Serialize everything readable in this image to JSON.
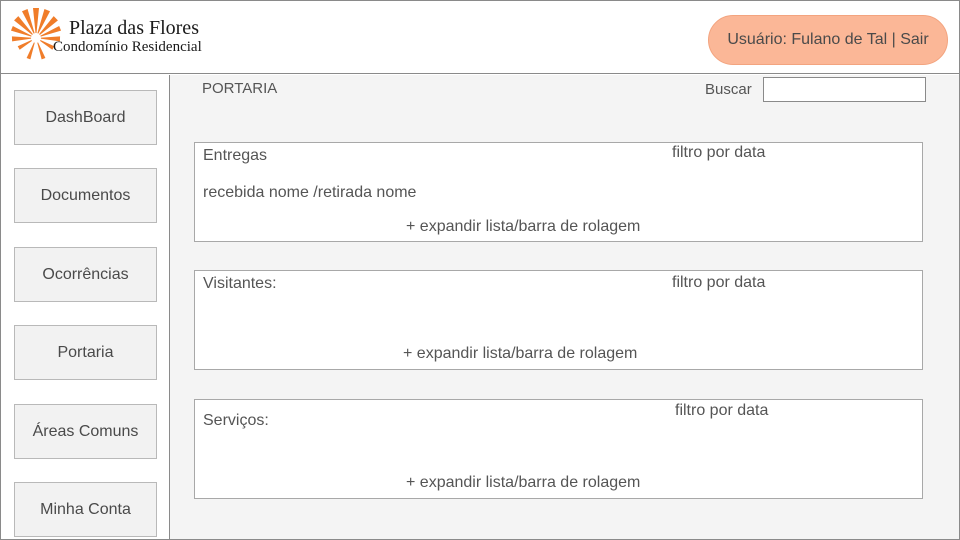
{
  "header": {
    "brand_title": "Plaza das Flores",
    "brand_subtitle": "Condomínio Residencial",
    "user_label": "Usuário: Fulano de Tal | Sair",
    "logo_icon": "flower-sun-logo-icon",
    "accent_color": "#fbb797",
    "logo_color": "#f07d2a"
  },
  "sidebar": {
    "items": [
      {
        "label": "DashBoard"
      },
      {
        "label": "Documentos"
      },
      {
        "label": "Ocorrências"
      },
      {
        "label": "Portaria"
      },
      {
        "label": "Áreas Comuns"
      },
      {
        "label": "Minha Conta"
      }
    ]
  },
  "main": {
    "page_title": "PORTARIA",
    "search_label": "Buscar",
    "search_value": "",
    "panels": [
      {
        "title": "Entregas",
        "filter": "filtro por data",
        "row": "recebida nome /retirada nome",
        "expand": "+ expandir lista/barra de rolagem"
      },
      {
        "title": "Visitantes:",
        "filter": "filtro por data",
        "expand": "+ expandir lista/barra de rolagem"
      },
      {
        "title": "Serviços:",
        "filter": "filtro por data",
        "expand": "+ expandir lista/barra de rolagem"
      }
    ]
  }
}
